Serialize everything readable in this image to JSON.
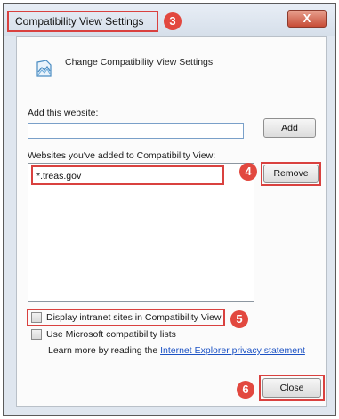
{
  "window": {
    "title": "Compatibility View Settings",
    "close_symbol": "X"
  },
  "header": {
    "icon": "compatibility-view-icon",
    "text": "Change Compatibility View Settings"
  },
  "add_section": {
    "label": "Add this website:",
    "input_value": "",
    "add_button": "Add"
  },
  "list_section": {
    "label": "Websites you've added to Compatibility View:",
    "items": [
      "*.treas.gov"
    ],
    "remove_button": "Remove"
  },
  "options": {
    "intranet": {
      "label": "Display intranet sites in Compatibility View",
      "checked": false
    },
    "ms_lists": {
      "label": "Use Microsoft compatibility lists",
      "checked": false
    }
  },
  "learn_more": {
    "prefix": "Learn more by reading the ",
    "link": "Internet Explorer privacy statement"
  },
  "close_button": "Close",
  "callouts": [
    "3",
    "4",
    "5",
    "6"
  ],
  "colors": {
    "callout": "#e2483f",
    "link": "#1c52c4"
  }
}
